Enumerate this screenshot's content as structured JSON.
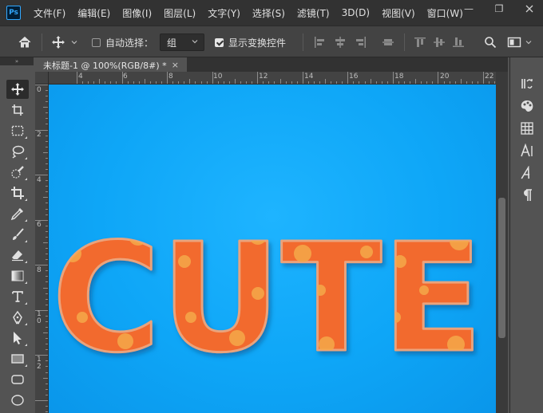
{
  "app": {
    "logo": "Ps"
  },
  "menu": [
    "文件(F)",
    "编辑(E)",
    "图像(I)",
    "图层(L)",
    "文字(Y)",
    "选择(S)",
    "滤镜(T)",
    "3D(D)",
    "视图(V)",
    "窗口(W)"
  ],
  "window_controls": {
    "minimize": "—",
    "restore": "❐"
  },
  "options": {
    "auto_select_label": "自动选择：",
    "auto_select_checked": false,
    "select_value": "组",
    "show_transform_label": "显示变换控件",
    "show_transform_checked": true
  },
  "collapse_glyph": "»",
  "document": {
    "tab_title": "未标题-1 @ 100%(RGB/8#) *",
    "close_glyph": "×"
  },
  "ruler": {
    "h_labels": [
      "4",
      "6",
      "8",
      "10",
      "12",
      "14",
      "16",
      "18",
      "20",
      "22"
    ],
    "v_labels": [
      "0",
      "2",
      "4",
      "6",
      "8",
      "1 0",
      "1 2"
    ]
  },
  "canvas_text": {
    "content": "CUTE"
  },
  "colors": {
    "canvas": "#0ea6f7",
    "letter_fill": "#f26a2e",
    "letter_stroke": "#e9a57d",
    "dots": "#f5a94a"
  },
  "icons": {
    "tools": [
      "move-tool-icon",
      "artboard-tool-icon",
      "marquee-tool-icon",
      "lasso-tool-icon",
      "quick-selection-icon",
      "crop-tool-icon",
      "eyedropper-icon",
      "brush-tool-icon",
      "eraser-tool-icon",
      "gradient-tool-icon",
      "type-tool-icon",
      "pen-tool-icon",
      "path-selection-icon",
      "rectangle-tool-icon",
      "rounded-rectangle-icon",
      "ellipse-tool-icon"
    ],
    "right": [
      "history-icon",
      "swatches-icon",
      "grid-icon",
      "character-icon",
      "glyphs-icon",
      "paragraph-icon"
    ]
  }
}
